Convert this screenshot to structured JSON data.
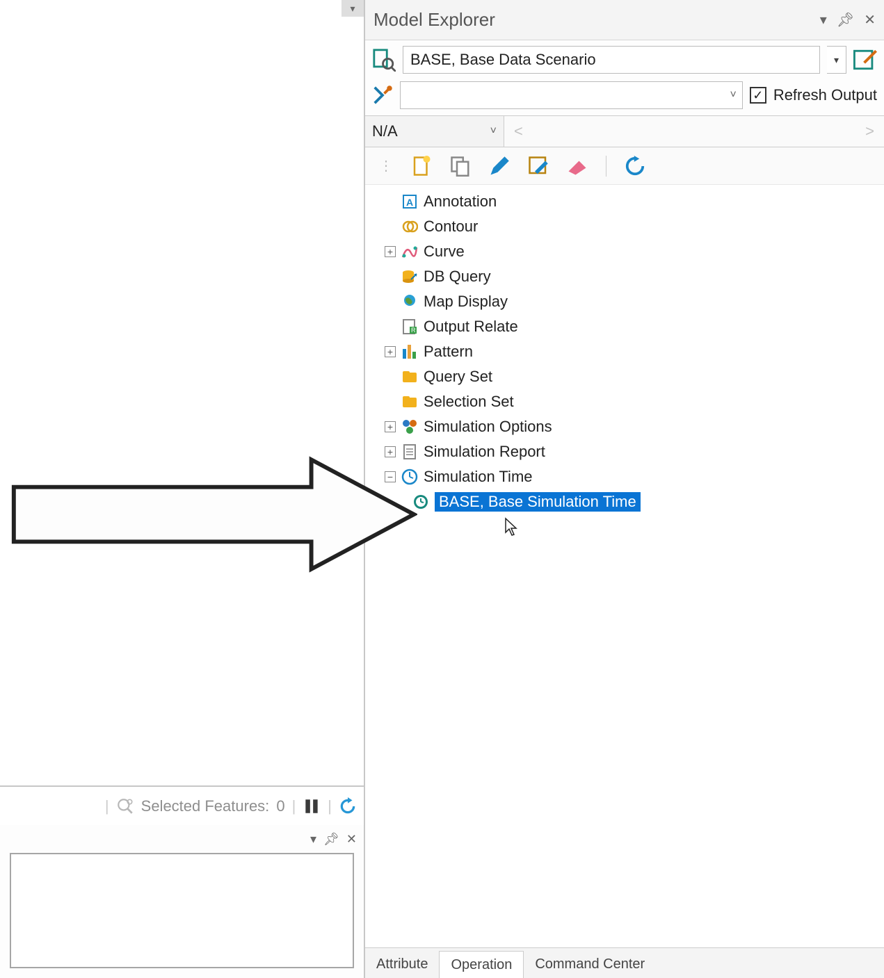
{
  "panel": {
    "title": "Model Explorer"
  },
  "scenario": {
    "value": "BASE, Base Data Scenario"
  },
  "filter": {
    "refresh_label": "Refresh Output",
    "refresh_checked": true
  },
  "na": {
    "label": "N/A"
  },
  "tree": {
    "items": [
      {
        "label": "Annotation",
        "icon": "annotation",
        "expandable": false
      },
      {
        "label": "Contour",
        "icon": "contour",
        "expandable": false
      },
      {
        "label": "Curve",
        "icon": "curve",
        "expandable": true,
        "expanded": false
      },
      {
        "label": "DB Query",
        "icon": "dbquery",
        "expandable": false
      },
      {
        "label": "Map Display",
        "icon": "mapdisplay",
        "expandable": false
      },
      {
        "label": "Output Relate",
        "icon": "outputrelate",
        "expandable": false
      },
      {
        "label": "Pattern",
        "icon": "pattern",
        "expandable": true,
        "expanded": false
      },
      {
        "label": "Query Set",
        "icon": "queryset",
        "expandable": false
      },
      {
        "label": "Selection Set",
        "icon": "selectionset",
        "expandable": false
      },
      {
        "label": "Simulation Options",
        "icon": "simoptions",
        "expandable": true,
        "expanded": false
      },
      {
        "label": "Simulation Report",
        "icon": "simreport",
        "expandable": true,
        "expanded": false
      },
      {
        "label": "Simulation Time",
        "icon": "simtime",
        "expandable": true,
        "expanded": true
      }
    ],
    "child": {
      "label": "BASE, Base Simulation Time",
      "icon": "simtime-child"
    }
  },
  "tabs": {
    "items": [
      "Attribute",
      "Operation",
      "Command Center"
    ],
    "active": 1
  },
  "status": {
    "selected_label": "Selected Features:",
    "selected_count": 0
  }
}
